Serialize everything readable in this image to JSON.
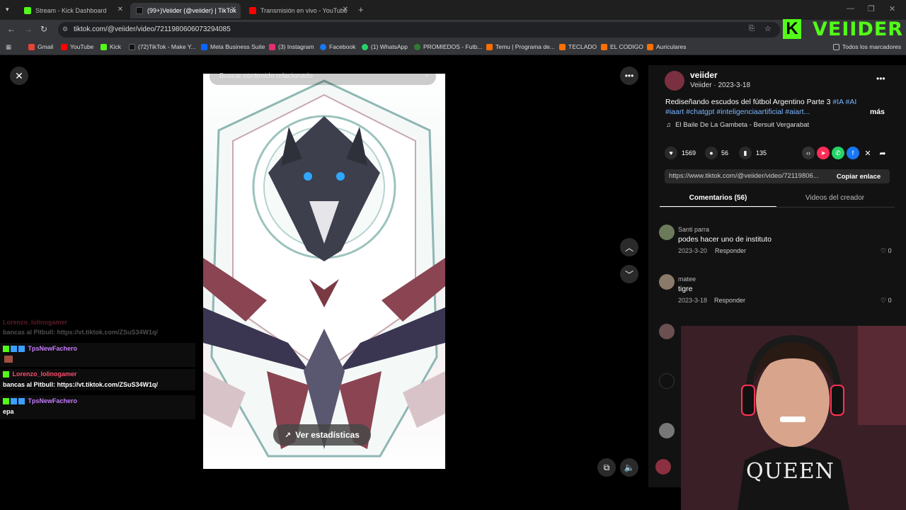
{
  "browser": {
    "tabs": [
      {
        "label": "Stream - Kick Dashboard",
        "fav_color": "#53fc18"
      },
      {
        "label": "(99+)Veiider (@veiider) | TikTok",
        "fav_color": "#111111"
      },
      {
        "label": "Transmisión en vivo - YouTube",
        "fav_color": "#ff0000"
      }
    ],
    "url": "tiktok.com/@veiider/video/7211980606073294085",
    "bookmarks": [
      {
        "label": "Gmail",
        "color": "#ea4335"
      },
      {
        "label": "YouTube",
        "color": "#ff0000"
      },
      {
        "label": "Kick",
        "color": "#53fc18"
      },
      {
        "label": "(72)TikTok - Make Y...",
        "color": "#111111"
      },
      {
        "label": "Meta Business Suite",
        "color": "#0866ff"
      },
      {
        "label": "(3) Instagram",
        "color": "#e1306c"
      },
      {
        "label": "Facebook",
        "color": "#1877f2"
      },
      {
        "label": "(1) WhatsApp",
        "color": "#25d366"
      },
      {
        "label": "PROMIEDOS - Futb...",
        "color": "#2e7d32"
      },
      {
        "label": "Temu | Programa de...",
        "color": "#ff6f00"
      },
      {
        "label": "TECLADO",
        "color": "#ff6f00"
      },
      {
        "label": "EL CODIGO",
        "color": "#ff6f00"
      },
      {
        "label": "Auriculares",
        "color": "#ff6f00"
      }
    ],
    "all_bookmarks": "Todos los marcadores"
  },
  "overlay": {
    "logo_k": "K",
    "logo_name": "VEIIDER"
  },
  "video": {
    "search_placeholder": "Buscar contenido relacionado",
    "stats_button": "Ver estadísticas"
  },
  "post": {
    "username": "veiider",
    "meta": "Veiider · 2023-3-18",
    "caption_main": "Rediseñando escudos del fútbol Argentino Parte 3 ",
    "caption_tags_1": "#IA #AI",
    "caption_tags_2": "#iaart #chatgpt #inteligenciaartificial #aiart...",
    "more": "más",
    "music": "El Baile De La Gambeta - Bersuit Vergarabat",
    "likes": "1569",
    "comments_count": "56",
    "saves": "135",
    "link": "https://www.tiktok.com/@veiider/video/72119806...",
    "copy_link": "Copiar enlace",
    "tab_comments": "Comentarios (56)",
    "tab_creator": "Videos del creador"
  },
  "comments": [
    {
      "user": "Santi parra",
      "text": "podes hacer uno de instituto",
      "date": "2023-3-20",
      "reply": "Responder",
      "likes": "0"
    },
    {
      "user": "matee",
      "text": "tigre",
      "date": "2023-3-18",
      "reply": "Responder",
      "likes": "0"
    }
  ],
  "chat": [
    {
      "user": "Lorenzo_lolinogamer",
      "msg": "bancas al Pitbull: https://vt.tiktok.com/ZSuS34W1q/"
    },
    {
      "user": "TpsNewFachero",
      "msg": ""
    },
    {
      "user": "Lorenzo_lolinogamer",
      "msg": "bancas al Pitbull: https://vt.tiktok.com/ZSuS34W1q/"
    },
    {
      "user": "TpsNewFachero",
      "msg": "epa"
    }
  ],
  "webcam": {
    "shirt_text": "QUEEN"
  }
}
